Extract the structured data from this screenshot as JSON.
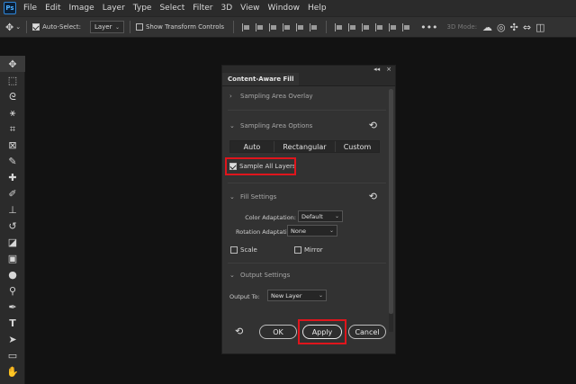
{
  "app": {
    "logo": "Ps"
  },
  "menu": [
    "File",
    "Edit",
    "Image",
    "Layer",
    "Type",
    "Select",
    "Filter",
    "3D",
    "View",
    "Window",
    "Help"
  ],
  "options_bar": {
    "auto_select_label": "Auto-Select:",
    "auto_select_checked": true,
    "layer_select": "Layer",
    "show_transform_label": "Show Transform Controls",
    "show_transform_checked": false,
    "three_d_label": "3D Mode:"
  },
  "toolbar": {
    "tools": [
      "move-tool",
      "marquee-tool",
      "lasso-tool",
      "magic-wand-tool",
      "crop-tool",
      "frame-tool",
      "eyedropper-tool",
      "healing-brush-tool",
      "brush-tool",
      "clone-stamp-tool",
      "history-brush-tool",
      "eraser-tool",
      "gradient-tool",
      "blur-tool",
      "dodge-tool",
      "pen-tool",
      "type-tool",
      "path-selection-tool",
      "rectangle-tool",
      "hand-tool"
    ]
  },
  "panel": {
    "title": "Content-Aware Fill",
    "top_buttons": {
      "collapse": "◂◂",
      "close": "×"
    },
    "sections": {
      "sampling_overlay": "Sampling Area Overlay",
      "sampling_options": "Sampling Area Options",
      "fill_settings": "Fill Settings",
      "output_settings": "Output Settings"
    },
    "sampling_modes": [
      "Auto",
      "Rectangular",
      "Custom"
    ],
    "sample_all_layers": {
      "label": "Sample All Layers",
      "checked": true
    },
    "color_adaptation": {
      "label": "Color Adaptation:",
      "value": "Default"
    },
    "rotation_adaptation": {
      "label": "Rotation Adaptation:",
      "value": "None"
    },
    "scale": {
      "label": "Scale",
      "checked": false
    },
    "mirror": {
      "label": "Mirror",
      "checked": false
    },
    "output_to": {
      "label": "Output To:",
      "value": "New Layer"
    },
    "buttons": {
      "ok": "OK",
      "apply": "Apply",
      "cancel": "Cancel"
    }
  },
  "colors": {
    "highlight": "#e0151c",
    "panel_bg": "#323232",
    "canvas_bg": "#121212"
  }
}
